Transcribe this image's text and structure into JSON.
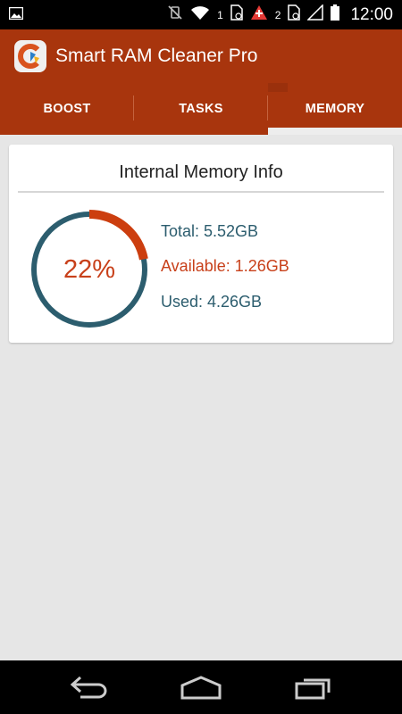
{
  "status_bar": {
    "time": "12:00",
    "sim1_label": "1",
    "sim2_label": "2"
  },
  "app": {
    "title": "Smart RAM Cleaner Pro",
    "accent_color": "#a8350d"
  },
  "tabs": [
    {
      "label": "BOOST",
      "active": false
    },
    {
      "label": "TASKS",
      "active": false
    },
    {
      "label": "MEMORY",
      "active": true
    }
  ],
  "memory_card": {
    "title": "Internal Memory Info",
    "percent_label": "22%",
    "percent_value": 0.22,
    "total": "Total: 5.52GB",
    "available": "Available: 1.26GB",
    "used": "Used: 4.26GB",
    "ring_color": "#2c5d6e",
    "fill_color": "#cc3e0f"
  },
  "nav_bar": {
    "icons": [
      "back-icon",
      "home-icon",
      "recents-icon"
    ]
  }
}
